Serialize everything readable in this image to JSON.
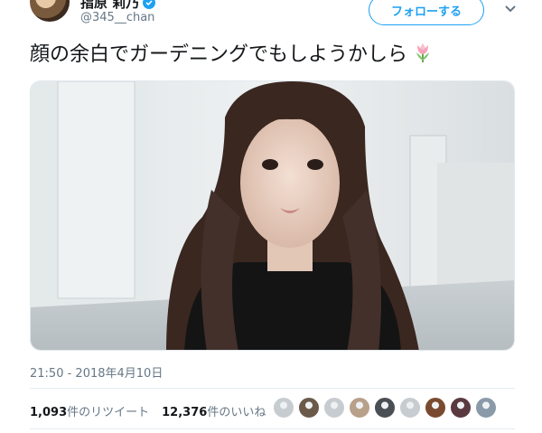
{
  "tweet": {
    "display_name": "指原 莉乃",
    "handle": "@345__chan",
    "follow_label": "フォローする",
    "text": "顔の余白でガーデニングでもしようかしら",
    "timestamp": "21:50 - 2018年4月10日",
    "retweets_count": "1,093",
    "retweets_label": "件のリツイート",
    "likes_count": "12,376",
    "likes_label": "件のいいね"
  },
  "colors": {
    "accent": "#1da1f2",
    "secondary_text": "#657786"
  },
  "icons": {
    "verified": "verified-badge-icon",
    "caret": "chevron-down-icon",
    "emoji": "tulip-emoji-icon"
  },
  "liker_avatars": [
    {
      "color": "#c7ccd1"
    },
    {
      "color": "#6b5a4a"
    },
    {
      "color": "#c7ccd1"
    },
    {
      "color": "#b8a08a"
    },
    {
      "color": "#4a4f55"
    },
    {
      "color": "#c7ccd1"
    },
    {
      "color": "#7a4a30"
    },
    {
      "color": "#5a3a40"
    },
    {
      "color": "#8a9aa8"
    }
  ]
}
